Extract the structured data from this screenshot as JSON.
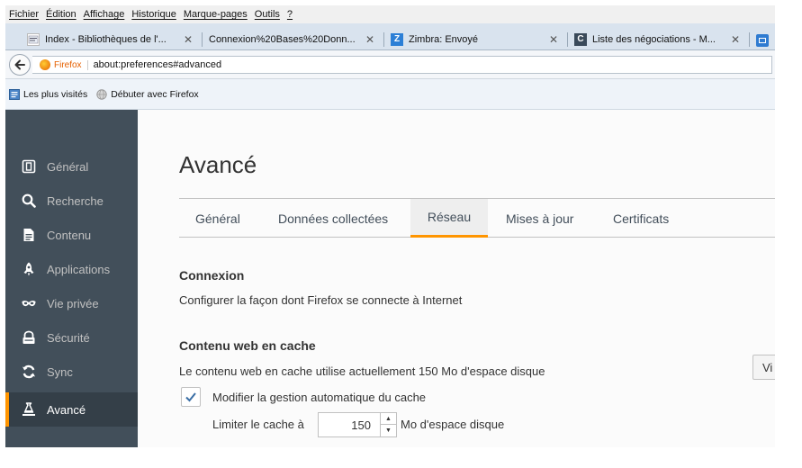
{
  "menubar": {
    "items": [
      "Fichier",
      "Édition",
      "Affichage",
      "Historique",
      "Marque-pages",
      "Outils",
      "?"
    ]
  },
  "tabs": [
    {
      "title": "Index - Bibliothèques de l'...",
      "favicon": "page-icon",
      "favicon_color": "#ffffff"
    },
    {
      "title": "Connexion%20Bases%20Donn...",
      "favicon": "",
      "favicon_color": ""
    },
    {
      "title": "Zimbra: Envoyé",
      "favicon": "zimbra-icon",
      "favicon_color": "#2c7fd6",
      "favicon_letter": "Z"
    },
    {
      "title": "Liste des négociations - M...",
      "favicon": "c-icon",
      "favicon_color": "#3a4a5a",
      "favicon_letter": "C"
    }
  ],
  "navbar": {
    "identity": "Firefox",
    "url": "about:preferences#advanced"
  },
  "bookmarks": [
    {
      "label": "Les plus visités",
      "icon": "bookmarks-icon"
    },
    {
      "label": "Débuter avec Firefox",
      "icon": "globe-icon"
    }
  ],
  "sidebar": {
    "items": [
      {
        "label": "Général",
        "icon": "general-icon"
      },
      {
        "label": "Recherche",
        "icon": "search-icon"
      },
      {
        "label": "Contenu",
        "icon": "content-icon"
      },
      {
        "label": "Applications",
        "icon": "applications-icon"
      },
      {
        "label": "Vie privée",
        "icon": "privacy-mask-icon"
      },
      {
        "label": "Sécurité",
        "icon": "security-icon"
      },
      {
        "label": "Sync",
        "icon": "sync-icon"
      },
      {
        "label": "Avancé",
        "icon": "advanced-icon"
      }
    ],
    "selected": "Avancé"
  },
  "main": {
    "title": "Avancé",
    "tabs": [
      "Général",
      "Données collectées",
      "Réseau",
      "Mises à jour",
      "Certificats"
    ],
    "selected_tab": "Réseau",
    "connection": {
      "heading": "Connexion",
      "description": "Configurer la façon dont Firefox se connecte à Internet"
    },
    "cache": {
      "heading": "Contenu web en cache",
      "description": "Le contenu web en cache utilise actuellement 150 Mo d'espace disque",
      "clear_button": "Vi",
      "override_label": "Modifier la gestion automatique du cache",
      "override_checked": true,
      "limit_label": "Limiter le cache à",
      "limit_value": "150",
      "limit_unit": "Mo d'espace disque"
    }
  },
  "colors": {
    "sidebar_bg": "#424f5a",
    "accent": "#ff9500",
    "tabstrip_bg": "#d9e3ee"
  }
}
